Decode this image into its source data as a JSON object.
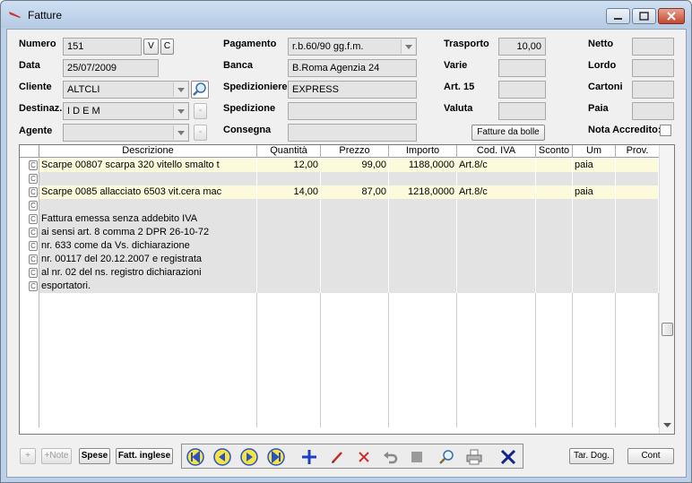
{
  "window": {
    "title": "Fatture"
  },
  "header": {
    "numero": {
      "label": "Numero",
      "value": "151",
      "v": "V",
      "c": "C"
    },
    "data": {
      "label": "Data",
      "value": "25/07/2009"
    },
    "cliente": {
      "label": "Cliente",
      "value": "ALTCLI"
    },
    "destinaz": {
      "label": "Destinaz.",
      "value": "I D E M",
      "btn": "-"
    },
    "agente": {
      "label": "Agente",
      "value": "",
      "btn": "-"
    },
    "pagamento": {
      "label": "Pagamento",
      "value": "r.b.60/90 gg.f.m."
    },
    "banca": {
      "label": "Banca",
      "value": "B.Roma Agenzia 24"
    },
    "spedizioniere": {
      "label": "Spedizioniere",
      "value": "EXPRESS"
    },
    "spedizione": {
      "label": "Spedizione",
      "value": ""
    },
    "consegna": {
      "label": "Consegna",
      "value": ""
    },
    "trasporto": {
      "label": "Trasporto",
      "value": "10,00"
    },
    "varie": {
      "label": "Varie",
      "value": ""
    },
    "art15": {
      "label": "Art. 15",
      "value": ""
    },
    "valuta": {
      "label": "Valuta",
      "value": ""
    },
    "netto": {
      "label": "Netto",
      "value": ""
    },
    "lordo": {
      "label": "Lordo",
      "value": ""
    },
    "cartoni": {
      "label": "Cartoni",
      "value": ""
    },
    "paia": {
      "label": "Paia",
      "value": ""
    },
    "nota_accredito": {
      "label": "Nota Accredito:"
    },
    "fatture_da_bolle": "Fatture da bolle"
  },
  "grid": {
    "columns": [
      "Descrizione",
      "Quantità",
      "Prezzo",
      "Importo",
      "Cod. IVA",
      "Sconto",
      "Um",
      "Prov."
    ],
    "rows": [
      {
        "style": "yel",
        "desc": "Scarpe 00807 scarpa 320 vitello smalto t",
        "qta": "12,00",
        "prezzo": "99,00",
        "importo": "1188,0000",
        "iva": "Art.8/c",
        "sconto": "",
        "um": "paia",
        "prov": ""
      },
      {
        "style": "gr",
        "desc": "",
        "qta": "",
        "prezzo": "",
        "importo": "",
        "iva": "",
        "sconto": "",
        "um": "",
        "prov": ""
      },
      {
        "style": "yel",
        "desc": "Scarpe 0085 allacciato 6503 vit.cera mac",
        "qta": "14,00",
        "prezzo": "87,00",
        "importo": "1218,0000",
        "iva": "Art.8/c",
        "sconto": "",
        "um": "paia",
        "prov": ""
      },
      {
        "style": "gr",
        "desc": "",
        "qta": "",
        "prezzo": "",
        "importo": "",
        "iva": "",
        "sconto": "",
        "um": "",
        "prov": ""
      },
      {
        "style": "gr",
        "desc": "Fattura emessa senza addebito IVA",
        "qta": "",
        "prezzo": "",
        "importo": "",
        "iva": "",
        "sconto": "",
        "um": "",
        "prov": ""
      },
      {
        "style": "gr",
        "desc": "ai sensi art. 8 comma 2 DPR 26-10-72",
        "qta": "",
        "prezzo": "",
        "importo": "",
        "iva": "",
        "sconto": "",
        "um": "",
        "prov": ""
      },
      {
        "style": "gr",
        "desc": "nr. 633 come da Vs. dichiarazione",
        "qta": "",
        "prezzo": "",
        "importo": "",
        "iva": "",
        "sconto": "",
        "um": "",
        "prov": ""
      },
      {
        "style": "gr",
        "desc": "nr.  00117 del 20.12.2007 e registrata",
        "qta": "",
        "prezzo": "",
        "importo": "",
        "iva": "",
        "sconto": "",
        "um": "",
        "prov": ""
      },
      {
        "style": "gr",
        "desc": "al nr. 02 del ns. registro dichiarazioni",
        "qta": "",
        "prezzo": "",
        "importo": "",
        "iva": "",
        "sconto": "",
        "um": "",
        "prov": ""
      },
      {
        "style": "gr",
        "desc": "esportatori.",
        "qta": "",
        "prezzo": "",
        "importo": "",
        "iva": "",
        "sconto": "",
        "um": "",
        "prov": ""
      }
    ],
    "row_checkbox_glyph": "C"
  },
  "footer": {
    "plus": "+",
    "plus_note": "+Note",
    "spese": "Spese",
    "fatt_inglese": "Fatt. inglese",
    "tar_dog": "Tar. Dog.",
    "cont": "Cont"
  },
  "colors": {
    "row_yellow": "#fdfadc",
    "row_gray": "#e3e3e3",
    "nav_yellow": "#f4e342",
    "nav_blue": "#2a52c7"
  }
}
